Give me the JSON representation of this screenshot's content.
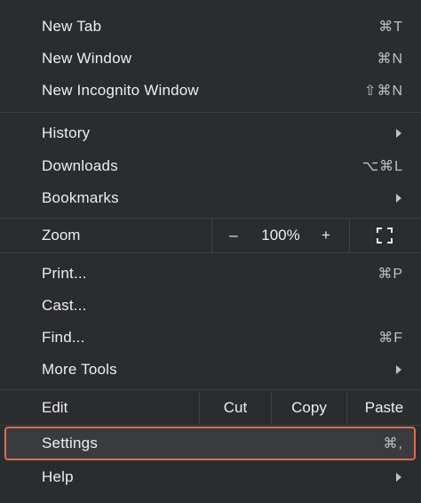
{
  "menu": {
    "new_tab": {
      "label": "New Tab",
      "shortcut": "⌘T"
    },
    "new_window": {
      "label": "New Window",
      "shortcut": "⌘N"
    },
    "new_incognito": {
      "label": "New Incognito Window",
      "shortcut": "⇧⌘N"
    },
    "history": {
      "label": "History"
    },
    "downloads": {
      "label": "Downloads",
      "shortcut": "⌥⌘L"
    },
    "bookmarks": {
      "label": "Bookmarks"
    },
    "zoom": {
      "label": "Zoom",
      "minus": "–",
      "level": "100%",
      "plus": "+"
    },
    "print": {
      "label": "Print...",
      "shortcut": "⌘P"
    },
    "cast": {
      "label": "Cast..."
    },
    "find": {
      "label": "Find...",
      "shortcut": "⌘F"
    },
    "more_tools": {
      "label": "More Tools"
    },
    "edit": {
      "label": "Edit",
      "cut": "Cut",
      "copy": "Copy",
      "paste": "Paste"
    },
    "settings": {
      "label": "Settings",
      "shortcut": "⌘,"
    },
    "help": {
      "label": "Help"
    }
  },
  "colors": {
    "background": "#2b2c2e",
    "highlight_border": "#e36a4b",
    "highlight_fill": "#3a3b3e"
  },
  "icons": {
    "submenu": "chevron-right-icon",
    "fullscreen": "fullscreen-icon"
  }
}
